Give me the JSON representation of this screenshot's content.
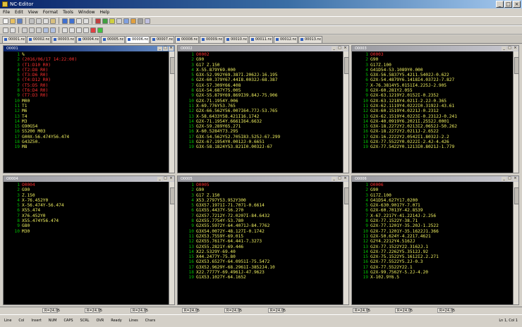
{
  "window": {
    "title": "NC-Editor"
  },
  "menu": [
    "File",
    "Edit",
    "View",
    "Format",
    "Tools",
    "Window",
    "Help"
  ],
  "tabs": [
    "00001.nc",
    "00002.nc",
    "00003.nc",
    "00004.nc",
    "00005.nc",
    "00006.nc",
    "00007.nc",
    "00008.nc",
    "00009.nc",
    "00010.nc",
    "00011.nc",
    "00012.nc",
    "00013.nc"
  ],
  "panes": [
    {
      "title": "O0001",
      "lines": [
        {
          "n": "1",
          "t": "%",
          "c": "yellow"
        },
        {
          "n": "2",
          "t": "(2016/06/17 14:22:00)",
          "c": "red"
        },
        {
          "n": "3",
          "t": "(T1:D10 R0)",
          "c": "red"
        },
        {
          "n": "4",
          "t": "(T2:D8 R0)",
          "c": "red"
        },
        {
          "n": "5",
          "t": "(T3:D6 R0)",
          "c": "red"
        },
        {
          "n": "6",
          "t": "(T4:D12 R0)",
          "c": "red"
        },
        {
          "n": "7",
          "t": "(T5:D5 R0)",
          "c": "red"
        },
        {
          "n": "8",
          "t": "(T6:D4 R0)",
          "c": "red"
        },
        {
          "n": "9",
          "t": "(T7:D3 R0)",
          "c": "red"
        },
        {
          "n": "10",
          "t": "M00",
          "c": "yellow"
        },
        {
          "n": "11",
          "t": "T1",
          "c": "yellow"
        },
        {
          "n": "12",
          "t": "M6",
          "c": "yellow"
        },
        {
          "n": "13",
          "t": "T4",
          "c": "yellow"
        },
        {
          "n": "14",
          "t": "M3",
          "c": "yellow"
        },
        {
          "n": "15",
          "t": "G90G54",
          "c": "yellow"
        },
        {
          "n": "16",
          "t": "S5200 M03",
          "c": "yellow"
        },
        {
          "n": "17",
          "t": "G00X-56.474Y56.474",
          "c": "yellow"
        },
        {
          "n": "18",
          "t": "G43Z50.",
          "c": "yellow"
        },
        {
          "n": "19",
          "t": "M8",
          "c": "yellow"
        }
      ]
    },
    {
      "title": "O0002",
      "lines": [
        {
          "n": "1",
          "t": "O0002",
          "c": "red"
        },
        {
          "n": "2",
          "t": "G90",
          "c": "yellow"
        },
        {
          "n": "3",
          "t": "G17 Z.150",
          "c": "yellow"
        },
        {
          "n": "4",
          "t": "X-55.879Y69.000",
          "c": "yellow"
        },
        {
          "n": "5",
          "t": "G3X-52.992Y69.387I.2062J-16.195",
          "c": "yellow"
        },
        {
          "n": "6",
          "t": "G2X-60.379Y67.44I8.0032J-68.387",
          "c": "yellow"
        },
        {
          "n": "7",
          "t": "G1X-57.309Y66.408",
          "c": "yellow"
        },
        {
          "n": "8",
          "t": "G1X-54.687Y75.005",
          "c": "yellow"
        },
        {
          "n": "9",
          "t": "G2X-55.879Y69.869I39.84J-75.906",
          "c": "yellow"
        },
        {
          "n": "10",
          "t": "G2X-71.1954Y.006",
          "c": "yellow"
        },
        {
          "n": "11",
          "t": "X-69.776Y53.765",
          "c": "yellow"
        },
        {
          "n": "12",
          "t": "G2X-66.562Y56.007I64.77J-53.765",
          "c": "yellow"
        },
        {
          "n": "13",
          "t": "X-58.6433Y58.421I16.1742",
          "c": "yellow"
        },
        {
          "n": "14",
          "t": "G2X-71.1954Y.6661I64.6632",
          "c": "yellow"
        },
        {
          "n": "15",
          "t": "G2X-59.289Y65.271",
          "c": "yellow"
        },
        {
          "n": "16",
          "t": "X-60.5284Y73.295",
          "c": "yellow"
        },
        {
          "n": "17",
          "t": "G3X-54.562Y52.705I83.525J-67.299",
          "c": "yellow"
        },
        {
          "n": "18",
          "t": "G2X-67.1954Y0.0012J-0.6651",
          "c": "yellow"
        },
        {
          "n": "19",
          "t": "G3X-58.1824Y53.821I0.0032J-67",
          "c": "yellow"
        }
      ]
    },
    {
      "title": "O0003",
      "lines": [
        {
          "n": "1",
          "t": "O0003",
          "c": "red"
        },
        {
          "n": "2",
          "t": "G90",
          "c": "yellow"
        },
        {
          "n": "3",
          "t": "G17Z.100",
          "c": "yellow"
        },
        {
          "n": "4",
          "t": "G41D54-53.1089Y0.000",
          "c": "yellow"
        },
        {
          "n": "5",
          "t": "G3X-56.5837Y5.4211.5402J-0.622",
          "c": "yellow"
        },
        {
          "n": "6",
          "t": "G2X-54.4879Y6.1418I4.0372J-7.827",
          "c": "yellow"
        },
        {
          "n": "7",
          "t": "X-76.3814Y5.0151I4.225J-2.905",
          "c": "yellow"
        },
        {
          "n": "8",
          "t": "G2X-60.281Y2.055",
          "c": "yellow"
        },
        {
          "n": "9",
          "t": "G2X-63.1219Y2.0152I-0.2352",
          "c": "yellow"
        },
        {
          "n": "10",
          "t": "G2X-63.1218Y4.021I-2.2J-0.365",
          "c": "yellow"
        },
        {
          "n": "11",
          "t": "G2X-62.1119Y4.0222I0.3192J-43.61",
          "c": "yellow"
        },
        {
          "n": "12",
          "t": "G2X-60.1519Y4.0221J-0.2312",
          "c": "yellow"
        },
        {
          "n": "13",
          "t": "G2X-62.1519Y4.0223I-0.2312J-0.241",
          "c": "yellow"
        },
        {
          "n": "14",
          "t": "G2X-40.0919Y6.2021I.2552J.0001",
          "c": "yellow"
        },
        {
          "n": "15",
          "t": "G3X-18.2272Y2.0213I2.0652J-50.262",
          "c": "yellow"
        },
        {
          "n": "16",
          "t": "G2X-18.2272Y2.0211J-2.6522",
          "c": "yellow"
        },
        {
          "n": "17",
          "t": "G2X-16.2222Y2.0542I1.8032J-2.2",
          "c": "yellow"
        },
        {
          "n": "18",
          "t": "G2X-77.5522Y0.0222I-2.4J-4.426",
          "c": "yellow"
        },
        {
          "n": "19",
          "t": "G2X-77.5422Y0.1213I0.8021J-1.779",
          "c": "yellow"
        }
      ]
    },
    {
      "title": "O0004",
      "lines": [
        {
          "n": "1",
          "t": "O0004",
          "c": "red"
        },
        {
          "n": "2",
          "t": "G90",
          "c": "yellow"
        },
        {
          "n": "3",
          "t": "Z.150",
          "c": "yellow"
        },
        {
          "n": "4",
          "t": "X-76.452Y0",
          "c": "yellow"
        },
        {
          "n": "5",
          "t": "X-56.474Y-56.474",
          "c": "yellow"
        },
        {
          "n": "6",
          "t": "X55.474",
          "c": "yellow"
        },
        {
          "n": "7",
          "t": "X76.452Y0",
          "c": "yellow"
        },
        {
          "n": "8",
          "t": "X55.474Y56.474",
          "c": "yellow"
        },
        {
          "n": "9",
          "t": "G80",
          "c": "yellow"
        },
        {
          "n": "10",
          "t": "M30",
          "c": "yellow"
        }
      ]
    },
    {
      "title": "O0005",
      "lines": [
        {
          "n": "1",
          "t": "O0005",
          "c": "red"
        },
        {
          "n": "2",
          "t": "G90",
          "c": "yellow"
        },
        {
          "n": "3",
          "t": "G17 Z.150",
          "c": "yellow"
        },
        {
          "n": "4",
          "t": "X53.2797Y53.952Y300",
          "c": "yellow"
        },
        {
          "n": "5",
          "t": "G3X57.1971I-71.7071-0.6614",
          "c": "yellow"
        },
        {
          "n": "6",
          "t": "G1X55.4437Y-56.270",
          "c": "yellow"
        },
        {
          "n": "7",
          "t": "G2X57.7212Y-72.0207I-84.6432",
          "c": "yellow"
        },
        {
          "n": "8",
          "t": "G2X55.7754Y-53.780",
          "c": "yellow"
        },
        {
          "n": "9",
          "t": "G2X55.5972Y-64.4071J-84.7762",
          "c": "yellow"
        },
        {
          "n": "10",
          "t": "G3X54.0072Y-48.127I-0.1742",
          "c": "yellow"
        },
        {
          "n": "11",
          "t": "G2X53.7559Y-69.015",
          "c": "yellow"
        },
        {
          "n": "12",
          "t": "G2X55.7617Y-64.441-7.3273",
          "c": "yellow"
        },
        {
          "n": "13",
          "t": "G2X55.2821Y-69.446",
          "c": "yellow"
        },
        {
          "n": "14",
          "t": "X22.5329Y-69.40",
          "c": "yellow"
        },
        {
          "n": "15",
          "t": "X44.2477Y-75.80",
          "c": "yellow"
        },
        {
          "n": "16",
          "t": "G2X53.6527Y-64.0951I-75.5472",
          "c": "yellow"
        },
        {
          "n": "17",
          "t": "G3X52.9629Y-68.2961I-3852J4.10",
          "c": "yellow"
        },
        {
          "n": "18",
          "t": "X22.7777Y-69.4961J-47.9623",
          "c": "yellow"
        },
        {
          "n": "19",
          "t": "G1X53.1027Y-64.1652",
          "c": "yellow"
        }
      ]
    },
    {
      "title": "O0006",
      "lines": [
        {
          "n": "1",
          "t": "O0006",
          "c": "red"
        },
        {
          "n": "2",
          "t": "G90",
          "c": "yellow"
        },
        {
          "n": "3",
          "t": "G17Z.100",
          "c": "yellow"
        },
        {
          "n": "4",
          "t": "G41D54.627Y17.0200",
          "c": "yellow"
        },
        {
          "n": "5",
          "t": "G2X-630.9017Y-7.071",
          "c": "yellow"
        },
        {
          "n": "6",
          "t": "G2X-60.7013Y-42.8539",
          "c": "yellow"
        },
        {
          "n": "7",
          "t": "X-67.2217Y-41.2214J-2.256",
          "c": "yellow"
        },
        {
          "n": "8",
          "t": "G2X-77.1522Y-38.71",
          "c": "yellow"
        },
        {
          "n": "9",
          "t": "G2X-77.1201Y-35.20J-1.2522",
          "c": "yellow"
        },
        {
          "n": "10",
          "t": "G2X-77.1201Y-35.1622J1.366",
          "c": "yellow"
        },
        {
          "n": "11",
          "t": "G2X-50.624Y-4.2217.4621",
          "c": "yellow"
        },
        {
          "n": "12",
          "t": "G2Y4.2212Y4.5162J",
          "c": "yellow"
        },
        {
          "n": "13",
          "t": "G2X-77.1522Y22.3162J.1",
          "c": "yellow"
        },
        {
          "n": "14",
          "t": "G2X-77.2262Y5.3512J.92",
          "c": "yellow"
        },
        {
          "n": "15",
          "t": "G2X-75.1522Y5.1612I2.2.271",
          "c": "yellow"
        },
        {
          "n": "16",
          "t": "G2X-77.5522Y5.2J-0.3",
          "c": "yellow"
        },
        {
          "n": "17",
          "t": "G2X-77.5522Y22.1",
          "c": "yellow"
        },
        {
          "n": "18",
          "t": "G2X-99.7562Y-5.2J-4.20",
          "c": "yellow"
        },
        {
          "n": "19",
          "t": "X-102.9Y6.5",
          "c": "yellow"
        }
      ]
    }
  ],
  "hscroll": [
    "R=24.05",
    "R=24.05",
    "R=24.05",
    "R=24.05",
    "R=24.05",
    "R=24.05",
    "R=24.05",
    "R=24.05",
    "R=24.05"
  ],
  "status": {
    "items": [
      "Line",
      "Col",
      "Insert",
      "NUM",
      "CAPS",
      "SCRL",
      "OVR",
      "Ready",
      "Lines",
      "Chars"
    ],
    "right": "Ln 1, Col 1"
  }
}
